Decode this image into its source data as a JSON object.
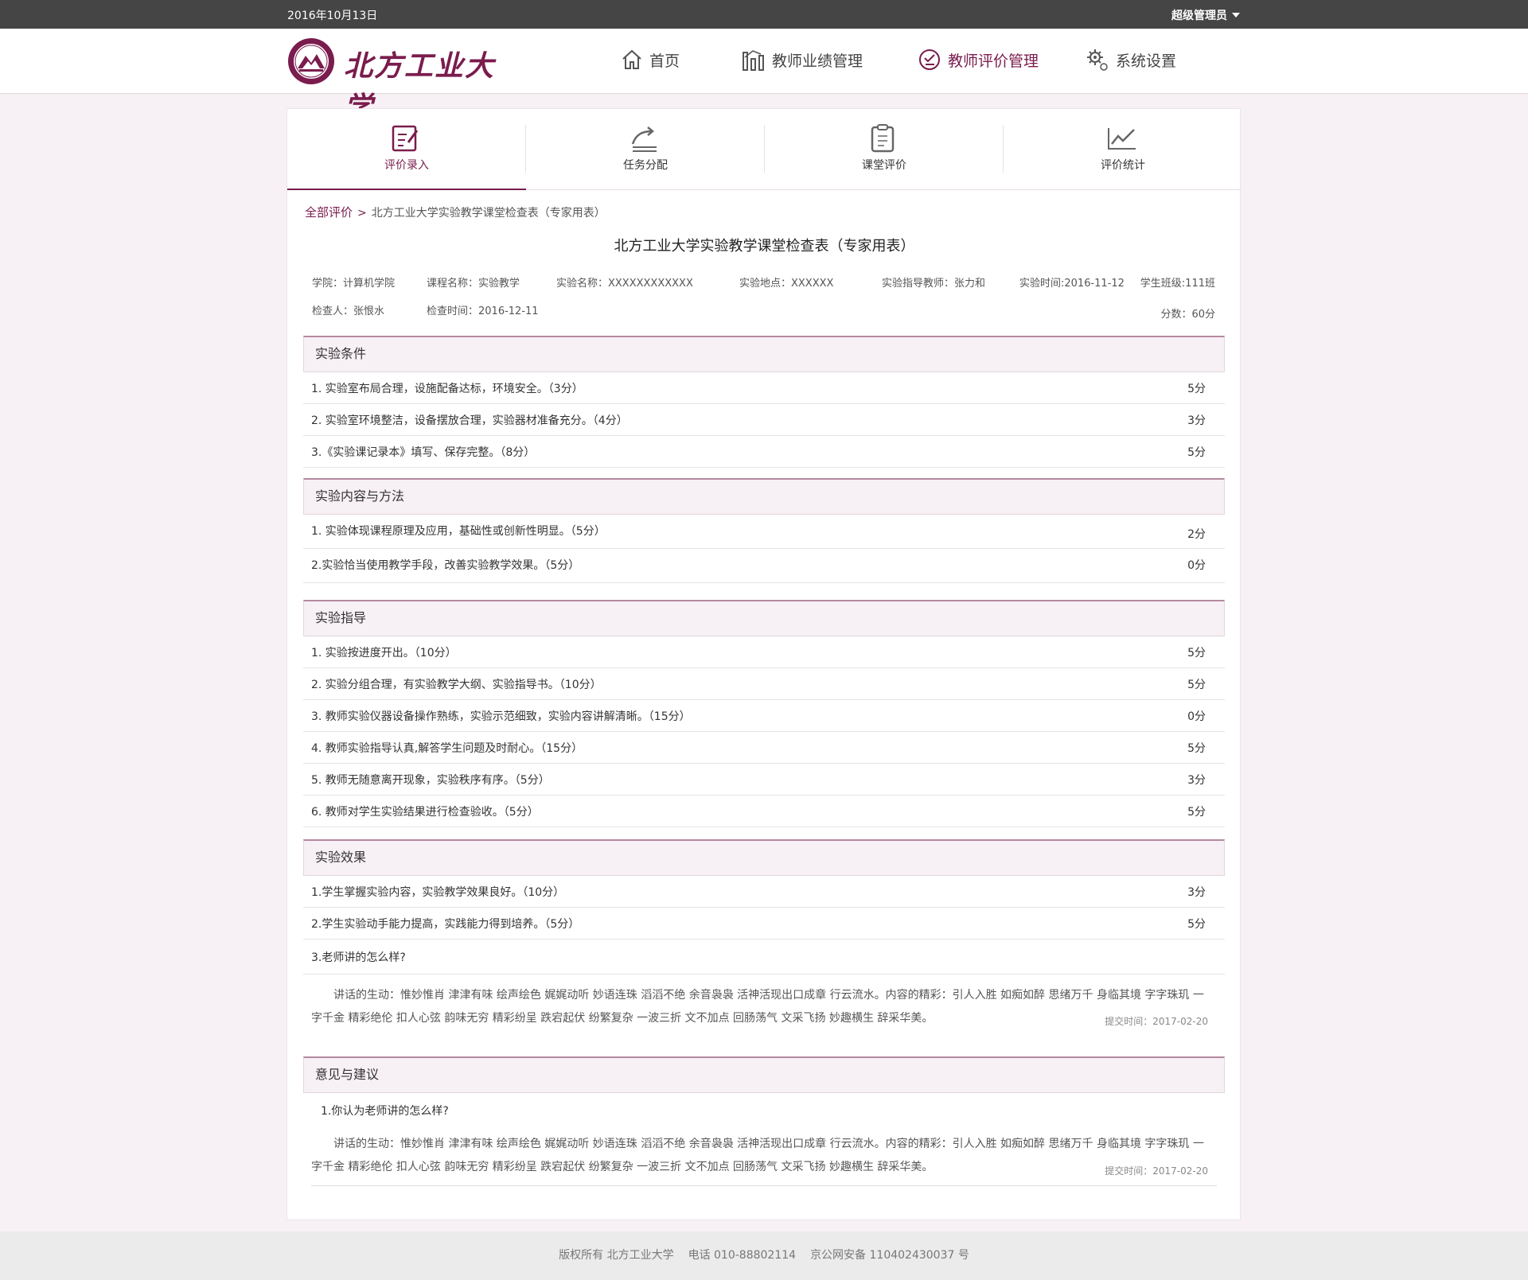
{
  "topbar": {
    "date": "2016年10月13日",
    "user": "超级管理员"
  },
  "header": {
    "logo_text": "北方工业大学",
    "nav": [
      {
        "label": "首页",
        "icon": "home-icon",
        "active": false
      },
      {
        "label": "教师业绩管理",
        "icon": "chart-bars-icon",
        "active": false
      },
      {
        "label": "教师评价管理",
        "icon": "evaluation-icon",
        "active": true
      },
      {
        "label": "系统设置",
        "icon": "gear-icon",
        "active": false
      }
    ]
  },
  "tabs": [
    {
      "label": "评价录入",
      "icon": "edit-form-icon",
      "active": true
    },
    {
      "label": "任务分配",
      "icon": "share-task-icon",
      "active": false
    },
    {
      "label": "课堂评价",
      "icon": "clipboard-icon",
      "active": false
    },
    {
      "label": "评价统计",
      "icon": "line-chart-icon",
      "active": false
    }
  ],
  "breadcrumb": {
    "root": "全部评价",
    "separator": ">",
    "current": "北方工业大学实验教学课堂检查表（专家用表）"
  },
  "form": {
    "title": "北方工业大学实验教学课堂检查表（专家用表）",
    "meta": {
      "college": "学院：计算机学院",
      "course": "课程名称：实验教学",
      "experiment": "实验名称：XXXXXXXXXXXX",
      "location": "实验地点：XXXXXX",
      "teacher": "实验指导教师：张力和",
      "exp_time": "实验时间:2016-11-12",
      "class": "学生班级:111班",
      "inspector": "检查人：张恨水",
      "check_time": "检查时间：2016-12-11",
      "score": "分数：60分"
    },
    "sections": [
      {
        "title": "实验条件",
        "items": [
          {
            "q": "1. 实验室布局合理，设施配备达标，环境安全。（3分）",
            "s": "5分"
          },
          {
            "q": "2. 实验室环境整洁，设备摆放合理，实验器材准备充分。（4分）",
            "s": "3分"
          },
          {
            "q": "3.《实验课记录本》填写、保存完整。（8分）",
            "s": "5分"
          }
        ]
      },
      {
        "title": "实验内容与方法",
        "items": [
          {
            "q": "1. 实验体现课程原理及应用，基础性或创新性明显。（5分）",
            "s": "2分"
          },
          {
            "q": "2.实验恰当使用教学手段，改善实验教学效果。（5分）",
            "s": "0分"
          }
        ]
      },
      {
        "title": "实验指导",
        "items": [
          {
            "q": "1. 实验按进度开出。（10分）",
            "s": "5分"
          },
          {
            "q": "2. 实验分组合理，有实验教学大纲、实验指导书。（10分）",
            "s": "5分"
          },
          {
            "q": "3. 教师实验仪器设备操作熟练，实验示范细致，实验内容讲解清晰。（15分）",
            "s": "0分"
          },
          {
            "q": "4. 教师实验指导认真,解答学生问题及时耐心。（15分）",
            "s": "5分"
          },
          {
            "q": "5. 教师无随意离开现象，实验秩序有序。（5分）",
            "s": "3分"
          },
          {
            "q": "6. 教师对学生实验结果进行检查验收。（5分）",
            "s": "5分"
          }
        ]
      },
      {
        "title": "实验效果",
        "items": [
          {
            "q": "1.学生掌握实验内容，实验教学效果良好。（10分）",
            "s": "3分"
          },
          {
            "q": "2.学生实验动手能力提高，实践能力得到培养。（5分）",
            "s": "5分"
          }
        ],
        "open_question": "3.老师讲的怎么样?",
        "comment": "讲话的生动：惟妙惟肖 津津有味 绘声绘色 娓娓动听 妙语连珠 滔滔不绝 余音袅袅 活神活现出口成章 行云流水。内容的精彩：引人入胜 如痴如醉 思绪万千 身临其境 字字珠玑 一字千金 精彩绝伦 扣人心弦 韵味无穷 精彩纷呈 跌宕起伏 纷繁复杂 一波三折 文不加点 回肠荡气 文采飞扬 妙趣横生 辞采华美。",
        "submit_time": "提交时间：2017-02-20"
      },
      {
        "title": "意见与建议",
        "open_question": "1.你认为老师讲的怎么样?",
        "comment": "讲话的生动：惟妙惟肖 津津有味 绘声绘色 娓娓动听 妙语连珠 滔滔不绝 余音袅袅 活神活现出口成章 行云流水。内容的精彩：引人入胜 如痴如醉 思绪万千 身临其境 字字珠玑 一字千金 精彩绝伦 扣人心弦 韵味无穷 精彩纷呈 跌宕起伏 纷繁复杂 一波三折 文不加点 回肠荡气 文采飞扬 妙趣横生 辞采华美。",
        "submit_time": "提交时间：2017-02-20"
      }
    ]
  },
  "footer": {
    "copyright": "版权所有 北方工业大学",
    "phone": "电话 010-88802114",
    "icp": "京公网安备 110402430037 号"
  },
  "colors": {
    "accent": "#7a1c4d",
    "topbar": "#454545",
    "section_bg": "#f7f0f4",
    "page_bg": "#f7f1f5"
  }
}
